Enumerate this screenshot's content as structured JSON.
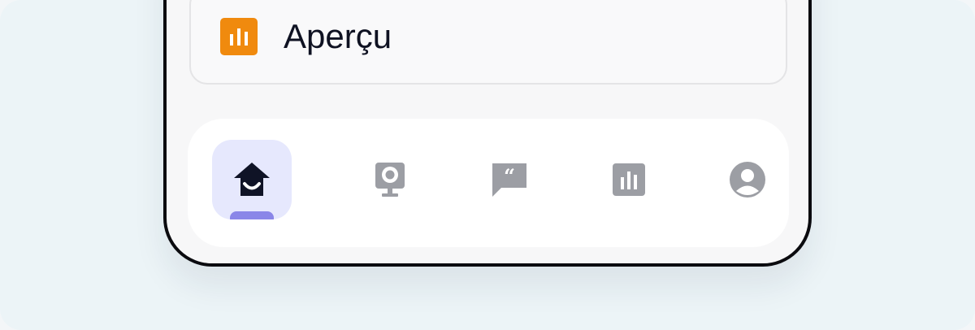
{
  "card": {
    "label": "Aperçu",
    "icon": "bar-chart-icon",
    "icon_color": "#f08a0e"
  },
  "tabbar": {
    "active_color": "#e6e8fd",
    "indicator_color": "#8a86e8",
    "icon_color_inactive": "#9c9ea4",
    "tabs": [
      {
        "icon": "home-icon",
        "active": true
      },
      {
        "icon": "webcam-icon",
        "active": false
      },
      {
        "icon": "quote-chat-icon",
        "active": false
      },
      {
        "icon": "bar-chart-icon",
        "active": false
      },
      {
        "icon": "profile-icon",
        "active": false
      }
    ]
  }
}
